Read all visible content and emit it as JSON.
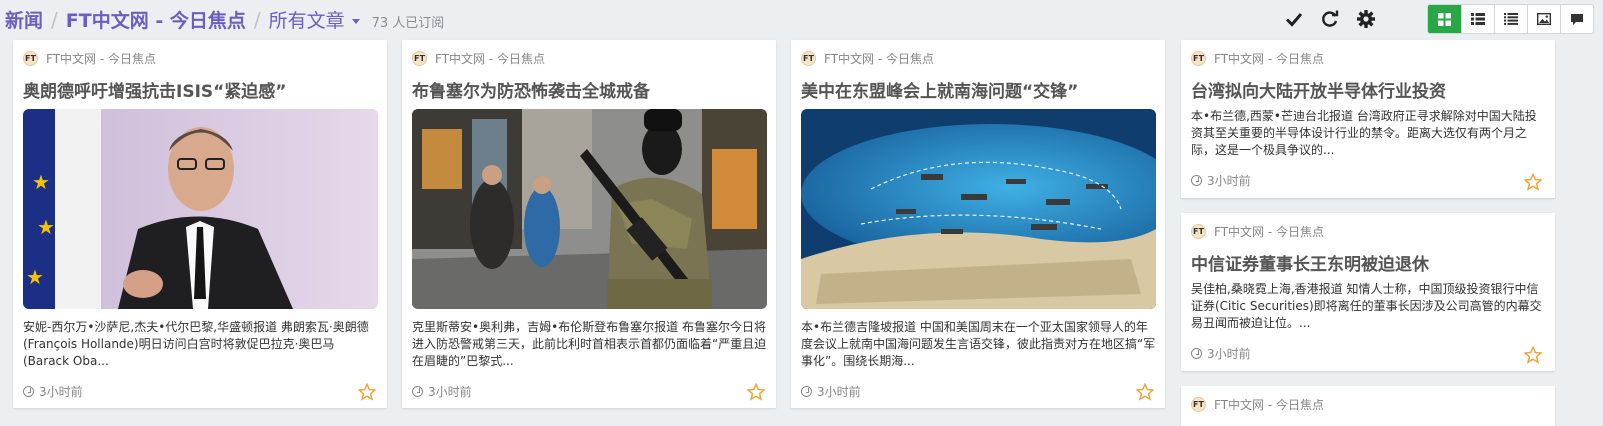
{
  "header": {
    "crumb1": "新闻",
    "crumb2": "FT中文网 - 今日焦点",
    "crumb3": "所有文章",
    "subscribers": "73 人已订阅"
  },
  "toolbar": {
    "mark_read": "checkmark-icon",
    "refresh": "refresh-icon",
    "settings": "gear-icon",
    "views": [
      "grid-view-icon",
      "list-view-icon",
      "compact-list-icon",
      "image-view-icon",
      "comment-view-icon"
    ],
    "active_view": 0,
    "accent": "#28a745"
  },
  "cards": [
    {
      "source": "FT中文网 - 今日焦点",
      "title": "奥朗德呼吁增强抗击ISIS“紧迫感”",
      "description": "安妮-西尔万•沙萨尼,杰夫•代尔巴黎,华盛顿报道 弗朗索瓦·奥朗德(François Hollande)明日访问白宫时将敦促巴拉克·奥巴马(Barack Oba...",
      "time": "3小时前"
    },
    {
      "source": "FT中文网 - 今日焦点",
      "title": "布鲁塞尔为防恐怖袭击全城戒备",
      "description": "克里斯蒂安•奥利弗，吉姆•布伦斯登布鲁塞尔报道 布鲁塞尔今日将进入防恐警戒第三天，此前比利时首相表示首都仍面临着“严重且迫在眉睫的”巴黎式...",
      "time": "3小时前"
    },
    {
      "source": "FT中文网 - 今日焦点",
      "title": "美中在东盟峰会上就南海问题“交锋”",
      "description": "本•布兰德吉隆坡报道 中国和美国周末在一个亚太国家领导人的年度会议上就南中国海问题发生言语交锋，彼此指责对方在地区搞“军事化”。围绕长期海...",
      "time": "3小时前"
    },
    {
      "source": "FT中文网 - 今日焦点",
      "title": "台湾拟向大陆开放半导体行业投资",
      "description": "本•布兰德,西蒙•芒迪台北报道 台湾政府正寻求解除对中国大陆投资其至关重要的半导体设计行业的禁令。距离大选仅有两个月之际，这是一个极具争议的...",
      "time": "3小时前"
    },
    {
      "source": "FT中文网 - 今日焦点",
      "title": "中信证券董事长王东明被迫退休",
      "description": "吴佳柏,桑晓霓上海,香港报道 知情人士称，中国顶级投资银行中信证券(Citic Securities)即将离任的董事长因涉及公司高管的内幕交易丑闻而被迫让位。...",
      "time": "3小时前"
    },
    {
      "source": "FT中文网 - 今日焦点"
    }
  ]
}
